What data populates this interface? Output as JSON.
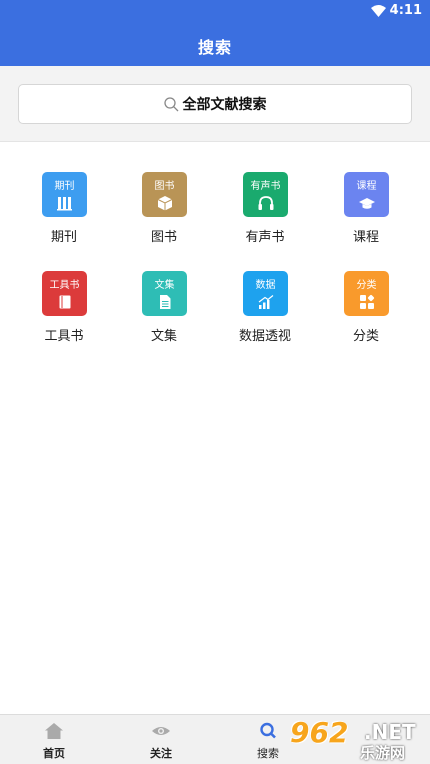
{
  "status": {
    "time": "4:11"
  },
  "header": {
    "title": "搜索"
  },
  "search": {
    "placeholder": "全部文献搜索"
  },
  "grid": [
    {
      "tile_text": "期刊",
      "label": "期刊",
      "color": "#3d9df0",
      "icon": "books-icon"
    },
    {
      "tile_text": "图书",
      "label": "图书",
      "color": "#b99456",
      "icon": "box-icon"
    },
    {
      "tile_text": "有声书",
      "label": "有声书",
      "color": "#1aaa6e",
      "icon": "headphones-icon"
    },
    {
      "tile_text": "课程",
      "label": "课程",
      "color": "#6b84f0",
      "icon": "graduation-cap-icon"
    },
    {
      "tile_text": "工具书",
      "label": "工具书",
      "color": "#dc3b3b",
      "icon": "book-icon"
    },
    {
      "tile_text": "文集",
      "label": "文集",
      "color": "#2ebdb5",
      "icon": "document-icon"
    },
    {
      "tile_text": "数据",
      "label": "数据透视",
      "color": "#1ea2ee",
      "icon": "chart-icon"
    },
    {
      "tile_text": "分类",
      "label": "分类",
      "color": "#f99a2c",
      "icon": "category-icon"
    }
  ],
  "bottom_nav": [
    {
      "label": "首页",
      "icon": "home-icon"
    },
    {
      "label": "关注",
      "icon": "eye-icon"
    },
    {
      "label": "搜索",
      "icon": "search-icon",
      "active": true
    }
  ],
  "watermark": {
    "number": "962",
    "suffix": ".NET",
    "site": "乐游网"
  },
  "colors": {
    "primary": "#3b6fe0",
    "active_nav": "#3b6fe0",
    "inactive_nav": "#aaaaaa"
  }
}
